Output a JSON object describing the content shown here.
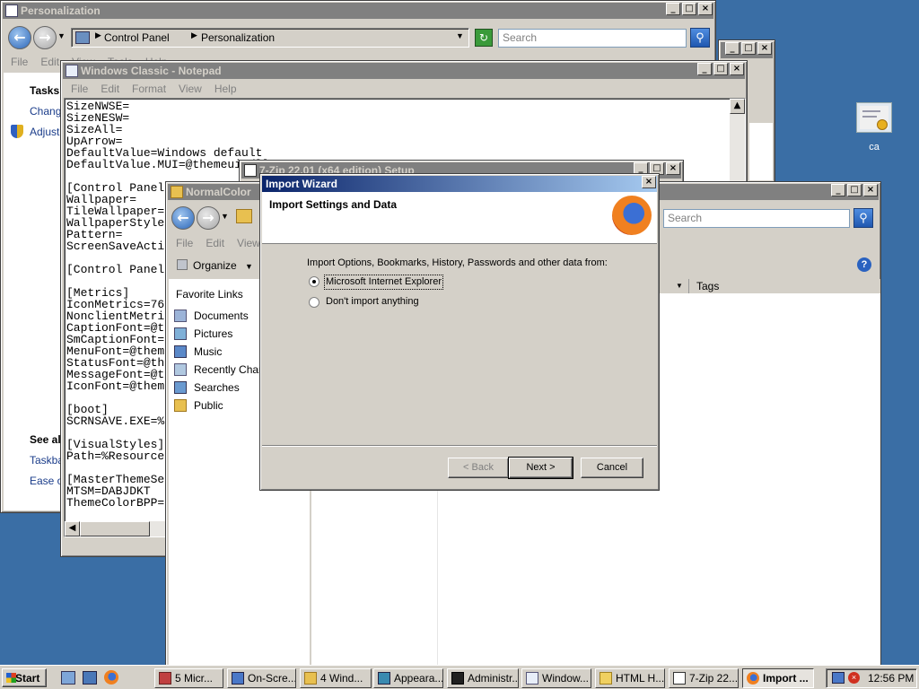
{
  "personalization": {
    "title": "Personalization",
    "breadcrumb": [
      "Control Panel",
      "Personalization"
    ],
    "search_placeholder": "Search",
    "menu": [
      "File",
      "Edit",
      "View",
      "Tools",
      "Help"
    ],
    "tasks_heading": "Tasks",
    "task_items": [
      "Change",
      "Adjust"
    ],
    "see_also_heading": "See al",
    "see_also_items": [
      "Taskba",
      "Ease of"
    ]
  },
  "notepad": {
    "title": "Windows Classic - Notepad",
    "menu": [
      "File",
      "Edit",
      "Format",
      "View",
      "Help"
    ],
    "lines": [
      "SizeNWSE=",
      "SizeNESW=",
      "SizeAll=",
      "UpArrow=",
      "DefaultValue=Windows default",
      "DefaultValue.MUI=@themeui.dll",
      "",
      "[Control Panel",
      "Wallpaper=",
      "TileWallpaper=",
      "WallpaperStyle",
      "Pattern=",
      "ScreenSaveActi",
      "",
      "[Control Panel",
      "",
      "[Metrics]",
      "IconMetrics=76",
      "NonclientMetri",
      "CaptionFont=@t",
      "SmCaptionFont=",
      "MenuFont=@them",
      "StatusFont=@th",
      "MessageFont=@t",
      "IconFont=@them",
      "",
      "[boot]",
      "SCRNSAVE.EXE=%",
      "",
      "[VisualStyles]",
      "Path=%Resource",
      "",
      "[MasterThemeSe",
      "MTSM=DABJDKT",
      "ThemeColorBPP="
    ]
  },
  "sevenzip": {
    "title": "7-Zip 22.01 (x64 edition) Setup"
  },
  "explorer": {
    "title": "NormalColor",
    "menu": [
      "File",
      "Edit",
      "View"
    ],
    "organize_label": "Organize",
    "search_placeholder": "Search",
    "favorites_heading": "Favorite Links",
    "favorites": [
      "Documents",
      "Pictures",
      "Music",
      "Recently Chang",
      "Searches",
      "Public"
    ],
    "tags_header": "Tags"
  },
  "wizard": {
    "title": "Import Wizard",
    "header": "Import Settings and Data",
    "prompt": "Import Options, Bookmarks, History, Passwords and other data from:",
    "options": [
      "Microsoft Internet Explorer",
      "Don't import anything"
    ],
    "selected_option": 0,
    "back_label": "< Back",
    "next_label": "Next >",
    "cancel_label": "Cancel"
  },
  "desktop": {
    "icon_label": "ca"
  },
  "taskbar": {
    "start_label": "Start",
    "tasks": [
      "5 Micr...",
      "On-Scre...",
      "4 Wind...",
      "Appeara...",
      "Administr...",
      "Window...",
      "HTML H...",
      "7-Zip 22...",
      "Import ..."
    ],
    "clock": "12:56 PM"
  },
  "colors": {
    "desktop": "#3a6ea5",
    "active_title": "#0a246a",
    "inactive_title": "#808080",
    "face": "#d4d0c8"
  }
}
